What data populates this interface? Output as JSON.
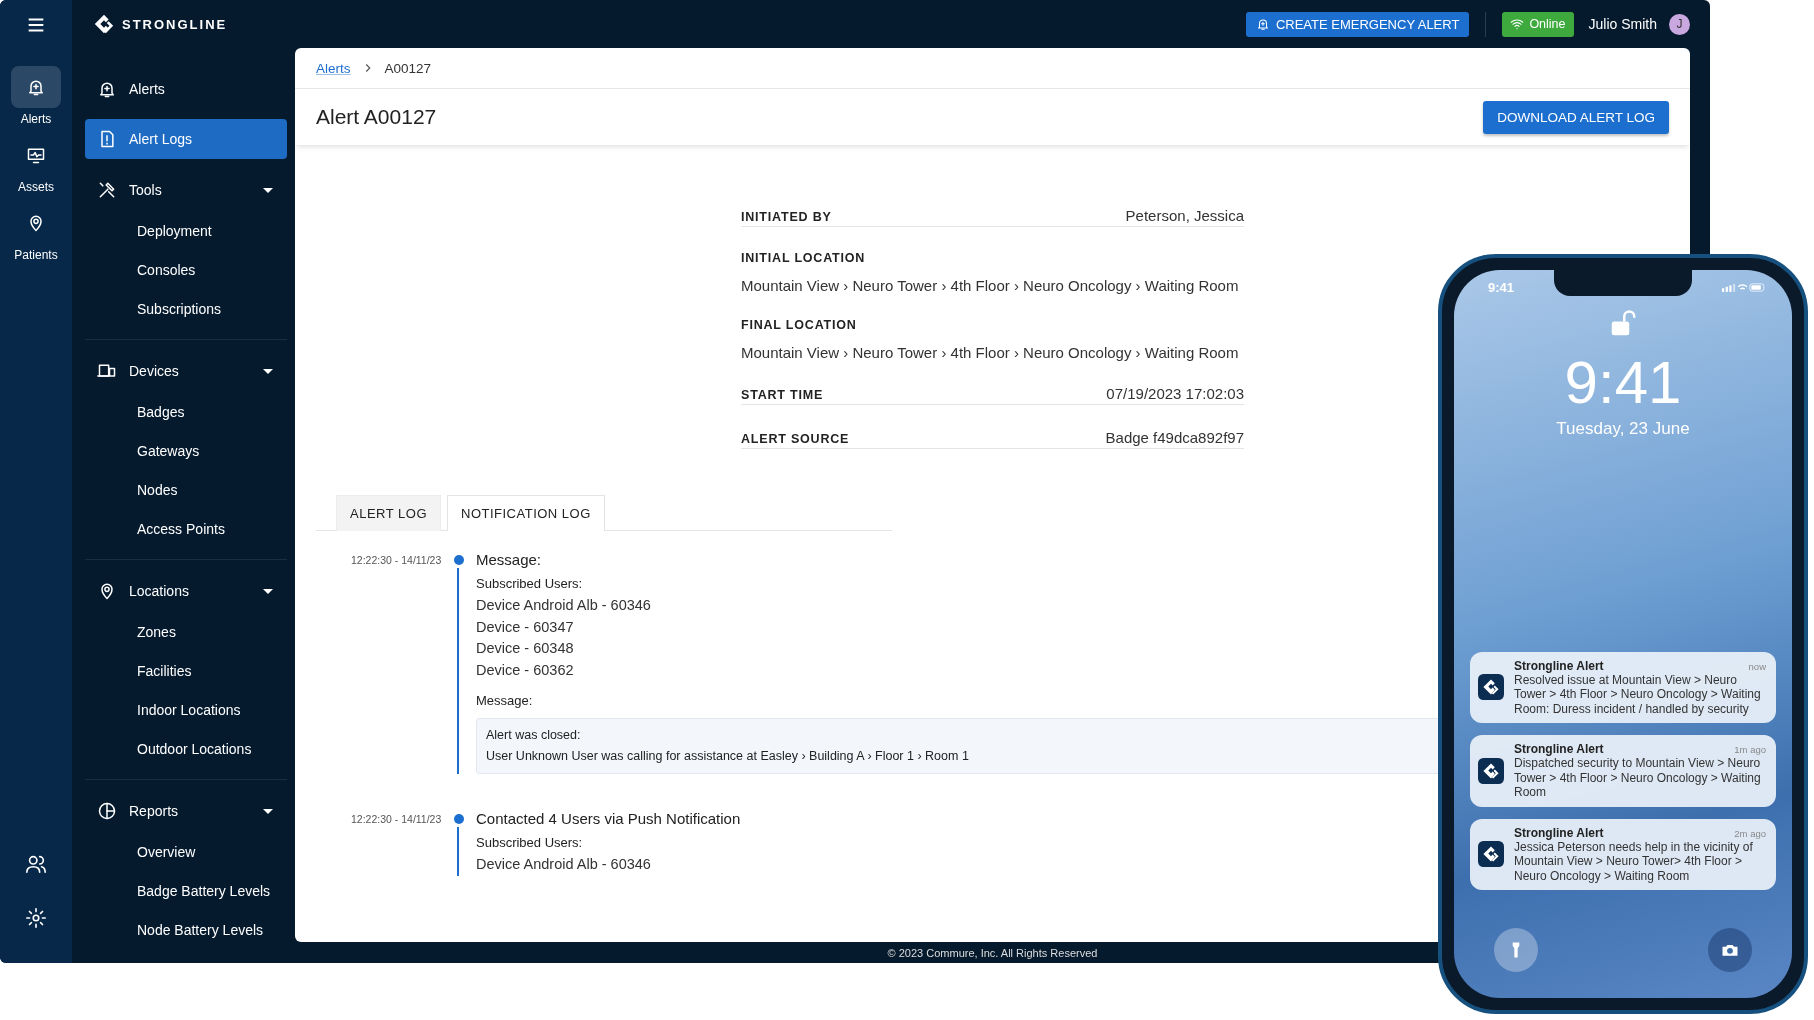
{
  "topbar": {
    "logo": "STRONGLINE",
    "emergency_button": "CREATE EMERGENCY ALERT",
    "status": "Online",
    "user_name": "Julio Smith",
    "avatar_initial": "J"
  },
  "rail": [
    {
      "label": "Alerts",
      "selected": true
    },
    {
      "label": "Assets",
      "selected": false
    },
    {
      "label": "Patients",
      "selected": false
    }
  ],
  "sidebar": {
    "links": [
      {
        "label": "Alerts",
        "selected": false
      },
      {
        "label": "Alert Logs",
        "selected": true
      }
    ],
    "groups": [
      {
        "label": "Tools",
        "expanded": true,
        "children": [
          {
            "label": "Deployment",
            "selected": false
          },
          {
            "label": "Consoles",
            "selected": false
          },
          {
            "label": "Subscriptions",
            "selected": false
          }
        ]
      },
      {
        "label": "Devices",
        "expanded": true,
        "children": [
          {
            "label": "Badges",
            "selected": false
          },
          {
            "label": "Gateways",
            "selected": false
          },
          {
            "label": "Nodes",
            "selected": false
          },
          {
            "label": "Access Points",
            "selected": false
          }
        ]
      },
      {
        "label": "Locations",
        "expanded": true,
        "children": [
          {
            "label": "Zones",
            "selected": false
          },
          {
            "label": "Facilities",
            "selected": false
          },
          {
            "label": "Indoor Locations",
            "selected": false
          },
          {
            "label": "Outdoor Locations",
            "selected": false
          }
        ]
      },
      {
        "label": "Reports",
        "expanded": true,
        "children": [
          {
            "label": "Overview",
            "selected": false
          },
          {
            "label": "Badge Battery Levels",
            "selected": false
          },
          {
            "label": "Node Battery Levels",
            "selected": false
          }
        ]
      }
    ]
  },
  "breadcrumb": {
    "link": "Alerts",
    "current": "A00127"
  },
  "title": "Alert A00127",
  "download_button": "DOWNLOAD ALERT LOG",
  "details": [
    {
      "label": "INITIATED BY",
      "value": "Peterson, Jessica",
      "kind": "inline"
    },
    {
      "label": "INITIAL LOCATION",
      "value": "Mountain View › Neuro Tower › 4th Floor › Neuro Oncology › Waiting Room",
      "kind": "stacked"
    },
    {
      "label": "FINAL LOCATION",
      "value": "Mountain View › Neuro Tower › 4th Floor › Neuro Oncology › Waiting Room",
      "kind": "stacked"
    },
    {
      "label": "START TIME",
      "value": "07/19/2023 17:02:03",
      "kind": "inline"
    },
    {
      "label": "ALERT SOURCE",
      "value": "Badge f49dca892f97",
      "kind": "inline"
    }
  ],
  "tabs": [
    {
      "label": "ALERT LOG",
      "selected": false
    },
    {
      "label": "NOTIFICATION LOG",
      "selected": true
    }
  ],
  "timeline": [
    {
      "time": "12:22:30 - 14/11/23",
      "heading": "Message:",
      "users_label": "Subscribed Users:",
      "users": [
        "Device Android Alb - 60346",
        "Device - 60347",
        "Device - 60348",
        "Device - 60362"
      ],
      "message_label": "Message:",
      "message": [
        "Alert was closed:",
        "User Unknown User was calling for assistance at Easley › Building A › Floor 1 › Room 1"
      ]
    },
    {
      "time": "12:22:30 - 14/11/23",
      "heading": "Contacted 4 Users via Push Notification",
      "users_label": "Subscribed Users:",
      "users": [
        "Device Android Alb - 60346"
      ]
    }
  ],
  "footer": "© 2023 Commure, Inc. All Rights Reserved",
  "phone": {
    "status_time": "9:41",
    "clock": "9:41",
    "date": "Tuesday, 23 June",
    "notifications": [
      {
        "app": "Strongline Alert",
        "time": "now",
        "text": "Resolved issue at Mountain View > Neuro Tower > 4th Floor > Neuro Oncology > Waiting Room: Duress incident / handled by security"
      },
      {
        "app": "Strongline Alert",
        "time": "1m ago",
        "text": "Dispatched security to Mountain View > Neuro Tower > 4th Floor > Neuro Oncology > Waiting Room"
      },
      {
        "app": "Strongline Alert",
        "time": "2m ago",
        "text": "Jessica Peterson needs help in the vicinity of Mountain View > Neuro Tower> 4th Floor > Neuro Oncology > Waiting Room"
      }
    ]
  }
}
